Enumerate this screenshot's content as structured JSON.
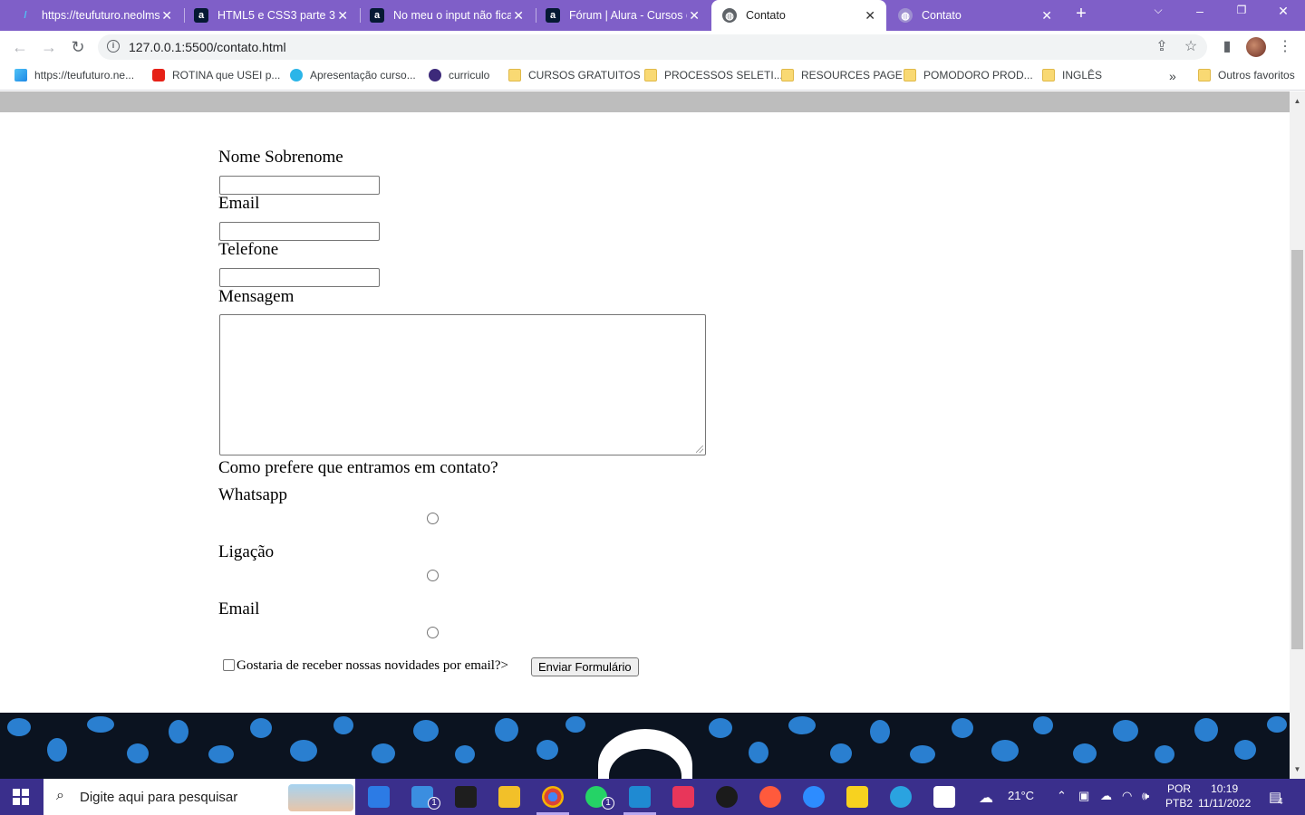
{
  "browser": {
    "tabs": [
      {
        "title": "https://teufuturo.neolms",
        "icon": "teufuturo-icon",
        "active": false
      },
      {
        "title": "HTML5 e CSS3 parte 3: t",
        "icon": "alura-icon",
        "active": false
      },
      {
        "title": "No meu o input não fica",
        "icon": "alura-icon",
        "active": false
      },
      {
        "title": "Fórum | Alura - Cursos o",
        "icon": "alura-icon",
        "active": false
      },
      {
        "title": "Contato",
        "icon": "globe-icon",
        "active": true
      },
      {
        "title": "Contato",
        "icon": "globe-icon",
        "active": false
      }
    ],
    "url": "127.0.0.1:5500/contato.html",
    "bookmarks": [
      {
        "label": "https://teufuturo.ne...",
        "icon": "teufuturo-icon"
      },
      {
        "label": "ROTINA que USEI p...",
        "icon": "youtube-icon"
      },
      {
        "label": "Apresentação curso...",
        "icon": "canva-icon"
      },
      {
        "label": "curriculo",
        "icon": "r-icon"
      },
      {
        "label": "CURSOS GRATUITOS",
        "icon": "folder-icon"
      },
      {
        "label": "PROCESSOS SELETI...",
        "icon": "folder-icon"
      },
      {
        "label": "RESOURCES PAGE",
        "icon": "folder-icon"
      },
      {
        "label": "POMODORO PROD...",
        "icon": "folder-icon"
      },
      {
        "label": "INGLÊS",
        "icon": "folder-icon"
      }
    ],
    "bookmarks_more": "»",
    "other_bookmarks": "Outros favoritos"
  },
  "form": {
    "name_label": "Nome Sobrenome",
    "email_label": "Email",
    "phone_label": "Telefone",
    "message_label": "Mensagem",
    "contact_question": "Como prefere que entramos em contato?",
    "options": [
      "Whatsapp",
      "Ligação",
      "Email"
    ],
    "newsletter_label": "Gostaria de receber nossas novidades por email?>",
    "submit_label": "Enviar Formulário"
  },
  "taskbar": {
    "search_placeholder": "Digite aqui para pesquisar",
    "mail_badge": "1",
    "whatsapp_badge": "1",
    "weather": "21°C",
    "lang_line1": "POR",
    "lang_line2": "PTB2",
    "time": "10:19",
    "date": "11/11/2022",
    "notification_count": "4"
  },
  "colors": {
    "tabstrip": "#7f5fc8",
    "taskbar": "#3a2f8c",
    "page_topbar": "#bdbdbd",
    "footer_bg": "#0b1320",
    "footer_dots": "#2a7fd0"
  }
}
